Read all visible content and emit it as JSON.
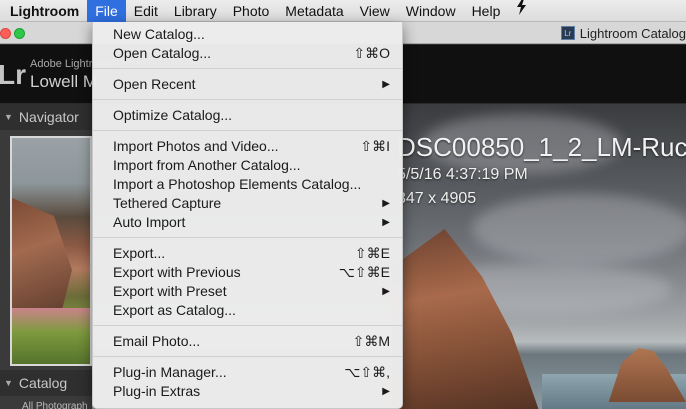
{
  "menubar": {
    "apple_glyph": "",
    "app_name": "Lightroom",
    "menus": [
      "File",
      "Edit",
      "Library",
      "Photo",
      "Metadata",
      "View",
      "Window",
      "Help"
    ],
    "extra_icon": "script-menu-icon",
    "active_menu": "File"
  },
  "window": {
    "title": "Lightroom Catalog",
    "badge": "Lr"
  },
  "identity": {
    "logo": "Lr",
    "small_text": "Adobe Lightroom",
    "name": "Lowell M"
  },
  "left_panel": {
    "navigator_label": "Navigator",
    "catalog_label": "Catalog",
    "all_photographs": "All Photograph"
  },
  "main": {
    "filename": "DSC00850_1_2_LM-Ruc",
    "date": "5/5/16 4:37:19 PM",
    "dimensions": "347 x 4905"
  },
  "file_menu": {
    "items": [
      {
        "label": "New Catalog...",
        "shortcut": ""
      },
      {
        "label": "Open Catalog...",
        "shortcut": "⇧⌘O"
      },
      {
        "label": "Open Recent",
        "submenu": true
      },
      {
        "label": "Optimize Catalog...",
        "shortcut": ""
      },
      {
        "label": "Import Photos and Video...",
        "shortcut": "⇧⌘I"
      },
      {
        "label": "Import from Another Catalog...",
        "shortcut": ""
      },
      {
        "label": "Import a Photoshop Elements Catalog...",
        "shortcut": ""
      },
      {
        "label": "Tethered Capture",
        "submenu": true
      },
      {
        "label": "Auto Import",
        "submenu": true
      },
      {
        "label": "Export...",
        "shortcut": "⇧⌘E"
      },
      {
        "label": "Export with Previous",
        "shortcut": "⌥⇧⌘E"
      },
      {
        "label": "Export with Preset",
        "submenu": true
      },
      {
        "label": "Export as Catalog...",
        "shortcut": ""
      },
      {
        "label": "Email Photo...",
        "shortcut": "⇧⌘M"
      },
      {
        "label": "Plug-in Manager...",
        "shortcut": "⌥⇧⌘,"
      },
      {
        "label": "Plug-in Extras",
        "submenu": true
      }
    ],
    "submenu_arrow": "▶"
  }
}
